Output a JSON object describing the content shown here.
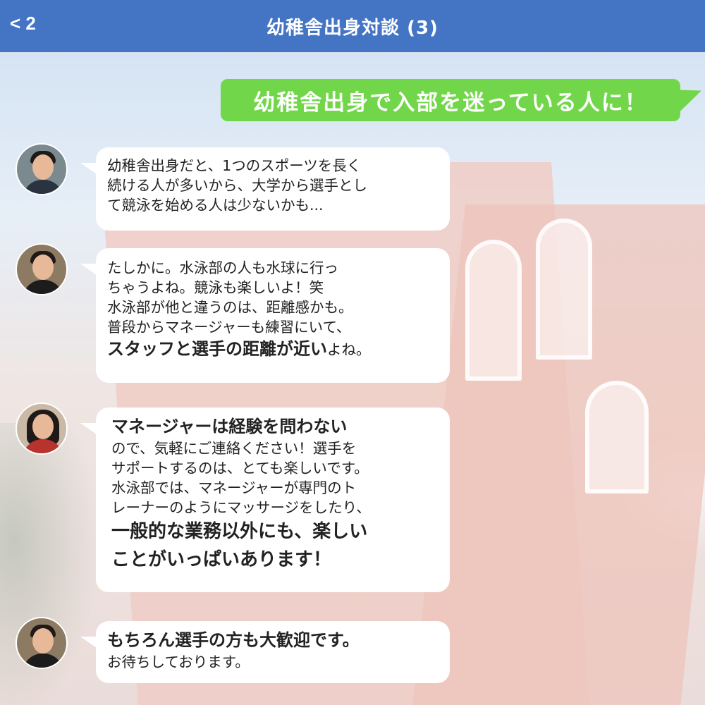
{
  "header": {
    "back_label": "< 2",
    "title": "幼稚舎出身対談 (3)",
    "bar_color": "#4474c4"
  },
  "outgoing": {
    "text": "幼稚舎出身で入部を迷っている人に！",
    "color": "#72d64a"
  },
  "messages": [
    {
      "lines": [
        "幼稚舎出身だと、1つのスポーツを長く",
        "続ける人が多いから、大学から選手とし",
        "て競泳を始める人は少ないかも..."
      ]
    },
    {
      "lines": [
        "たしかに。水泳部の人も水球に行っ",
        "ちゃうよね。競泳も楽しいよ！笑",
        "水泳部が他と違うのは、距離感かも。",
        "普段からマネージャーも練習にいて、"
      ],
      "emph": "スタッフと選手の距離が近い",
      "emph_tail": "よね。"
    },
    {
      "lead": "マネージャーは経験を問わない",
      "lines": [
        "ので、気軽にご連絡ください！選手を",
        "サポートするのは、とても楽しいです。",
        "水泳部では、マネージャーが専門のト",
        "レーナーのようにマッサージをしたり、"
      ],
      "tail_lines": [
        "一般的な業務以外にも、楽しい",
        "ことがいっぱいあります！"
      ]
    },
    {
      "lead": "もちろん選手の方も大歓迎です。",
      "lines": [
        "お待ちしております。"
      ]
    }
  ]
}
